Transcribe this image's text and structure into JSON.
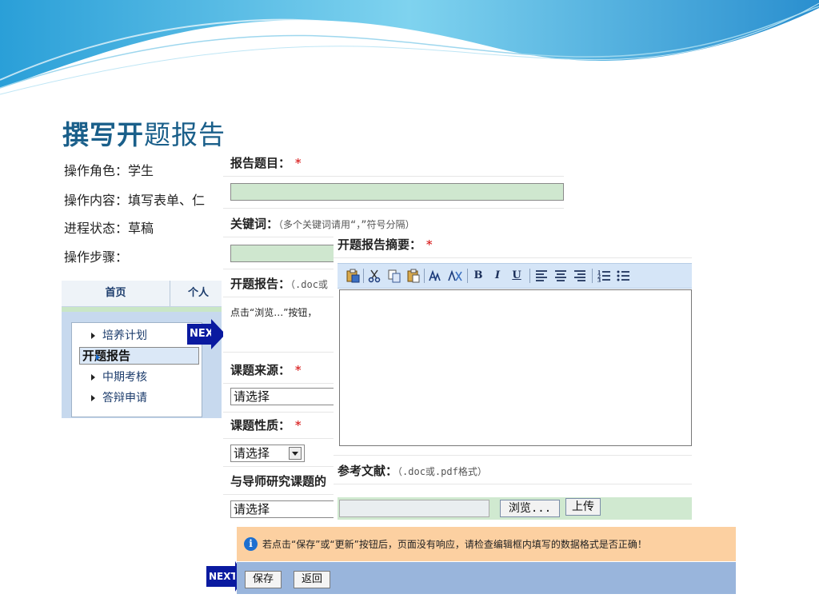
{
  "slide": {
    "title_bold": "撰写开",
    "title_rest": "题报告",
    "info_lines": [
      "操作角色：学生",
      "操作内容：填写表单、仁",
      "进程状态：草稿",
      "操作步骤："
    ]
  },
  "nav": {
    "tabs": [
      "首页",
      "个人"
    ],
    "menu": [
      {
        "label": "培养计划",
        "selected": false
      },
      {
        "label": "开题报告",
        "selected": true
      },
      {
        "label": "中期考核",
        "selected": false
      },
      {
        "label": "答辩申请",
        "selected": false
      }
    ]
  },
  "next_label": "NEXT",
  "next_label_partial": "NEX",
  "form": {
    "report_title_label": "报告题目：",
    "required_mark": "*",
    "keywords_label": "关键词：",
    "keywords_hint": "（多个关键词请用“，”符号分隔）",
    "opening_report_label": "开题报告：",
    "opening_report_hint": "（.doc或",
    "upload_note": "点击“浏览…”按钮，",
    "source_label": "课题来源：",
    "source_value": "请选择",
    "nature_label": "课题性质：",
    "nature_value": "请选择",
    "relation_label": "与导师研究课题的",
    "relation_value": "请选择"
  },
  "abstract": {
    "label": "开题报告摘要：",
    "toolbar": [
      "B",
      "I",
      "U"
    ],
    "ref_label": "参考文献：",
    "ref_hint": "（.doc或.pdf格式）",
    "browse_label": "浏览...",
    "upload_label": "上传"
  },
  "warning_text": "若点击“保存”或“更新”按钮后，页面没有响应，请检查编辑框内填写的数据格式是否正确！",
  "actions": {
    "save": "保存",
    "back": "返回"
  },
  "colors": {
    "title": "#1a5f8a",
    "field_green": "#cfe7cf",
    "warn_bg": "#fcd0a1",
    "action_bg": "#99b5dc",
    "required": "#d40000"
  }
}
